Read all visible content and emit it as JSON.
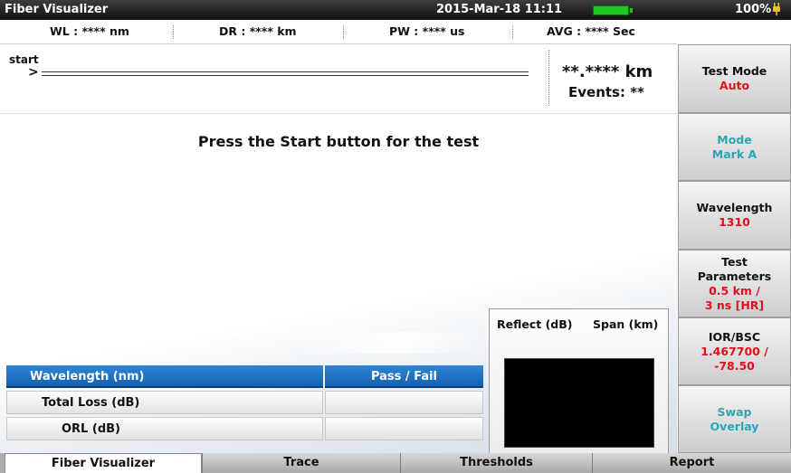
{
  "titlebar": {
    "app_title": "Fiber Visualizer",
    "datetime": "2015-Mar-18 11:11",
    "battery_percent": "100%",
    "battery_level": 1.0,
    "battery_icon": "battery-icon",
    "power_icon": "plug-icon"
  },
  "infobar": {
    "wl": "WL : **** nm",
    "dr": "DR : **** km",
    "pw": "PW : **** us",
    "avg": "AVG : **** Sec"
  },
  "summary": {
    "start_label": "start",
    "start_arrow": ">",
    "distance": "**.**** km",
    "events": "Events: **"
  },
  "main": {
    "prompt": "Press the Start button for the test"
  },
  "results_table": {
    "rows": [
      {
        "label": "Wavelength (nm)",
        "value": "Pass / Fail"
      },
      {
        "label": "Total Loss (dB)",
        "value": ""
      },
      {
        "label": "ORL (dB)",
        "value": ""
      }
    ]
  },
  "event_panel": {
    "reflect_label": "Reflect (dB)",
    "span_label": "Span (km)"
  },
  "side_panel": {
    "test_mode": {
      "label": "Test Mode",
      "value": "Auto"
    },
    "mode": {
      "label": "Mode",
      "value": "Mark A"
    },
    "wavelength": {
      "label": "Wavelength",
      "value": "1310"
    },
    "test_parameters": {
      "label1": "Test",
      "label2": "Parameters",
      "value1": "0.5 km /",
      "value2": "3 ns [HR]"
    },
    "ior_bsc": {
      "label": "IOR/BSC",
      "value1": "1.467700 /",
      "value2": "-78.50"
    },
    "swap_overlay": {
      "label1": "Swap",
      "label2": "Overlay"
    }
  },
  "tabs": [
    "Fiber Visualizer",
    "Trace",
    "Thresholds",
    "Report"
  ],
  "colors": {
    "accent_red": "#e0101e",
    "teal": "#2aa7b3",
    "header_blue": "#1f6fc0",
    "battery_green": "#22c622"
  }
}
